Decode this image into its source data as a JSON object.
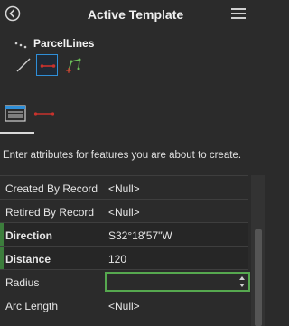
{
  "header": {
    "title": "Active Template"
  },
  "template": {
    "name": "ParcelLines"
  },
  "tools": [
    "line-tool",
    "two-point-line-tool",
    "polygon-tool"
  ],
  "instructions": "Enter attributes for features you are about to create.",
  "attributes": [
    {
      "label": "Created By Record",
      "value": "<Null>",
      "required": false
    },
    {
      "label": "Retired By Record",
      "value": "<Null>",
      "required": false
    },
    {
      "label": "Direction",
      "value": "S32°18'57\"W",
      "required": true
    },
    {
      "label": "Distance",
      "value": "120",
      "required": true
    },
    {
      "label": "Radius",
      "value": "",
      "required": false
    },
    {
      "label": "Arc Length",
      "value": "<Null>",
      "required": false
    }
  ],
  "colors": {
    "accent_blue": "#2f8fd8",
    "required_green": "#3c7d3c",
    "focus_green": "#56a84f"
  }
}
